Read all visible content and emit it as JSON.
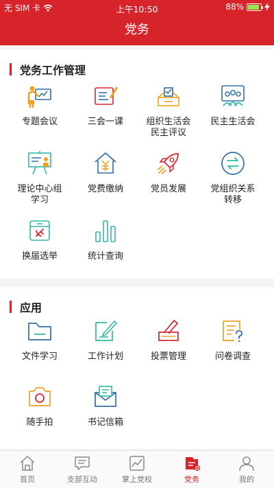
{
  "status_bar": {
    "carrier": "无 SIM 卡",
    "time": "上午10:50",
    "battery": "88%",
    "battery_level": 0.88
  },
  "nav": {
    "title": "党务"
  },
  "section_work": {
    "title": "党务工作管理",
    "items": [
      {
        "label": "专题会议",
        "icon": "presentation-icon"
      },
      {
        "label": "三会一课",
        "icon": "notebook-pen-icon"
      },
      {
        "label": "组织生活会\n民主评议",
        "icon": "ballot-box-icon"
      },
      {
        "label": "民主生活会",
        "icon": "group-meeting-icon"
      },
      {
        "label": "理论中心组\n学习",
        "icon": "teaching-board-icon"
      },
      {
        "label": "党费缴纳",
        "icon": "house-yuan-icon"
      },
      {
        "label": "党员发展",
        "icon": "rocket-icon"
      },
      {
        "label": "党组织关系\n转移",
        "icon": "transfer-arrows-icon"
      },
      {
        "label": "换届选举",
        "icon": "election-box-icon"
      },
      {
        "label": "统计查询",
        "icon": "bar-chart-icon"
      }
    ]
  },
  "section_apps": {
    "title": "应用",
    "items": [
      {
        "label": "文件学习",
        "icon": "folder-icon"
      },
      {
        "label": "工作计划",
        "icon": "edit-note-icon"
      },
      {
        "label": "投票管理",
        "icon": "vote-pen-icon"
      },
      {
        "label": "问卷调查",
        "icon": "questionnaire-icon"
      },
      {
        "label": "随手拍",
        "icon": "camera-icon"
      },
      {
        "label": "书记信箱",
        "icon": "mailbox-icon"
      }
    ]
  },
  "tab_bar": {
    "tabs": [
      {
        "label": "首页",
        "icon": "home-icon"
      },
      {
        "label": "支部互动",
        "icon": "chat-icon"
      },
      {
        "label": "掌上党校",
        "icon": "school-chart-icon"
      },
      {
        "label": "党务",
        "icon": "party-affairs-icon",
        "active": true
      },
      {
        "label": "我的",
        "icon": "profile-icon"
      }
    ]
  },
  "colors": {
    "primary": "#d7232a",
    "icon_orange": "#f0a020",
    "icon_blue": "#2f6ea8",
    "icon_teal": "#2fb8a8"
  }
}
